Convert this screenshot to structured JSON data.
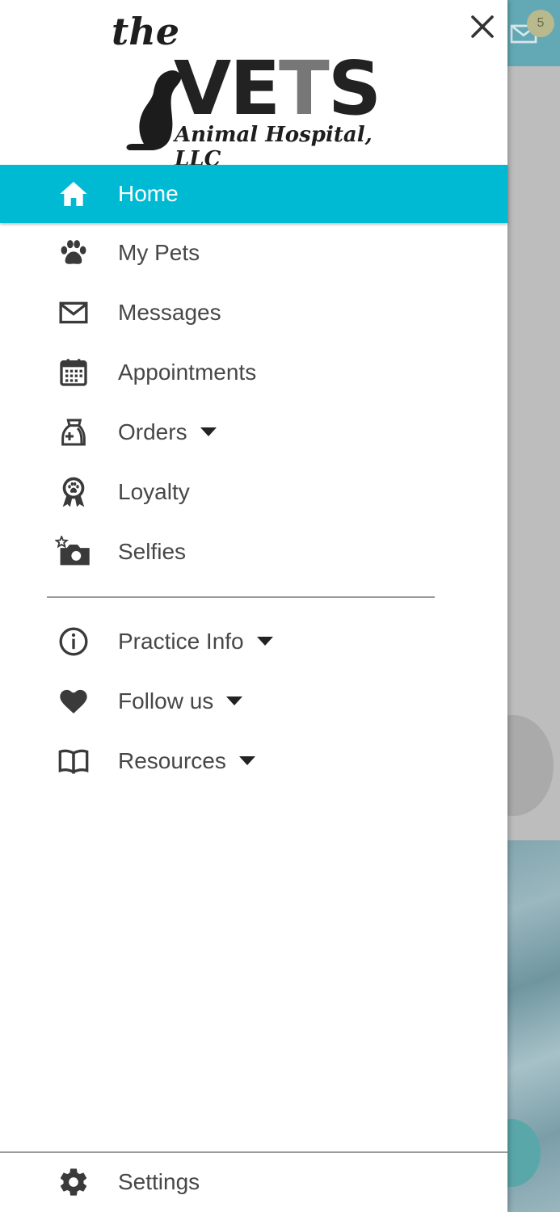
{
  "background": {
    "messages_badge": "5"
  },
  "drawer": {
    "logo": {
      "the": "the",
      "vets_a": "VE",
      "vets_b": "T",
      "vets_c": "S",
      "subtitle": "Animal Hospital, LLC"
    },
    "primary_items": [
      {
        "label": "Home",
        "icon": "home-icon",
        "active": true
      },
      {
        "label": "My Pets",
        "icon": "paw-icon"
      },
      {
        "label": "Messages",
        "icon": "envelope-icon"
      },
      {
        "label": "Appointments",
        "icon": "calendar-icon"
      },
      {
        "label": "Orders",
        "icon": "medicine-bag-icon",
        "expandable": true
      },
      {
        "label": "Loyalty",
        "icon": "award-ribbon-icon"
      },
      {
        "label": "Selfies",
        "icon": "camera-star-icon"
      }
    ],
    "secondary_items": [
      {
        "label": "Practice Info",
        "icon": "info-icon",
        "expandable": true
      },
      {
        "label": "Follow us",
        "icon": "heart-icon",
        "expandable": true
      },
      {
        "label": "Resources",
        "icon": "book-icon",
        "expandable": true
      }
    ],
    "settings": {
      "label": "Settings",
      "icon": "gear-icon"
    }
  },
  "colors": {
    "accent": "#00bad3",
    "text": "#474747",
    "icon": "#3a3a3a"
  }
}
